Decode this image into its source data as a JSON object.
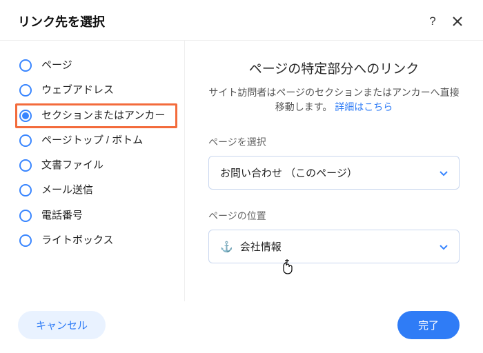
{
  "header": {
    "title": "リンク先を選択"
  },
  "left": {
    "options": [
      {
        "label": "ページ",
        "checked": false,
        "highlighted": false
      },
      {
        "label": "ウェブアドレス",
        "checked": false,
        "highlighted": false
      },
      {
        "label": "セクションまたはアンカー",
        "checked": true,
        "highlighted": true
      },
      {
        "label": "ページトップ / ボトム",
        "checked": false,
        "highlighted": false
      },
      {
        "label": "文書ファイル",
        "checked": false,
        "highlighted": false
      },
      {
        "label": "メール送信",
        "checked": false,
        "highlighted": false
      },
      {
        "label": "電話番号",
        "checked": false,
        "highlighted": false
      },
      {
        "label": "ライトボックス",
        "checked": false,
        "highlighted": false
      }
    ]
  },
  "right": {
    "title": "ページの特定部分へのリンク",
    "desc_prefix": "サイト訪問者はページのセクションまたはアンカーへ直接移動します。",
    "desc_link": "詳細はこちら",
    "page_select_label": "ページを選択",
    "page_select_value": "お問い合わせ （このページ）",
    "position_label": "ページの位置",
    "position_value": "会社情報"
  },
  "footer": {
    "cancel": "キャンセル",
    "done": "完了"
  }
}
